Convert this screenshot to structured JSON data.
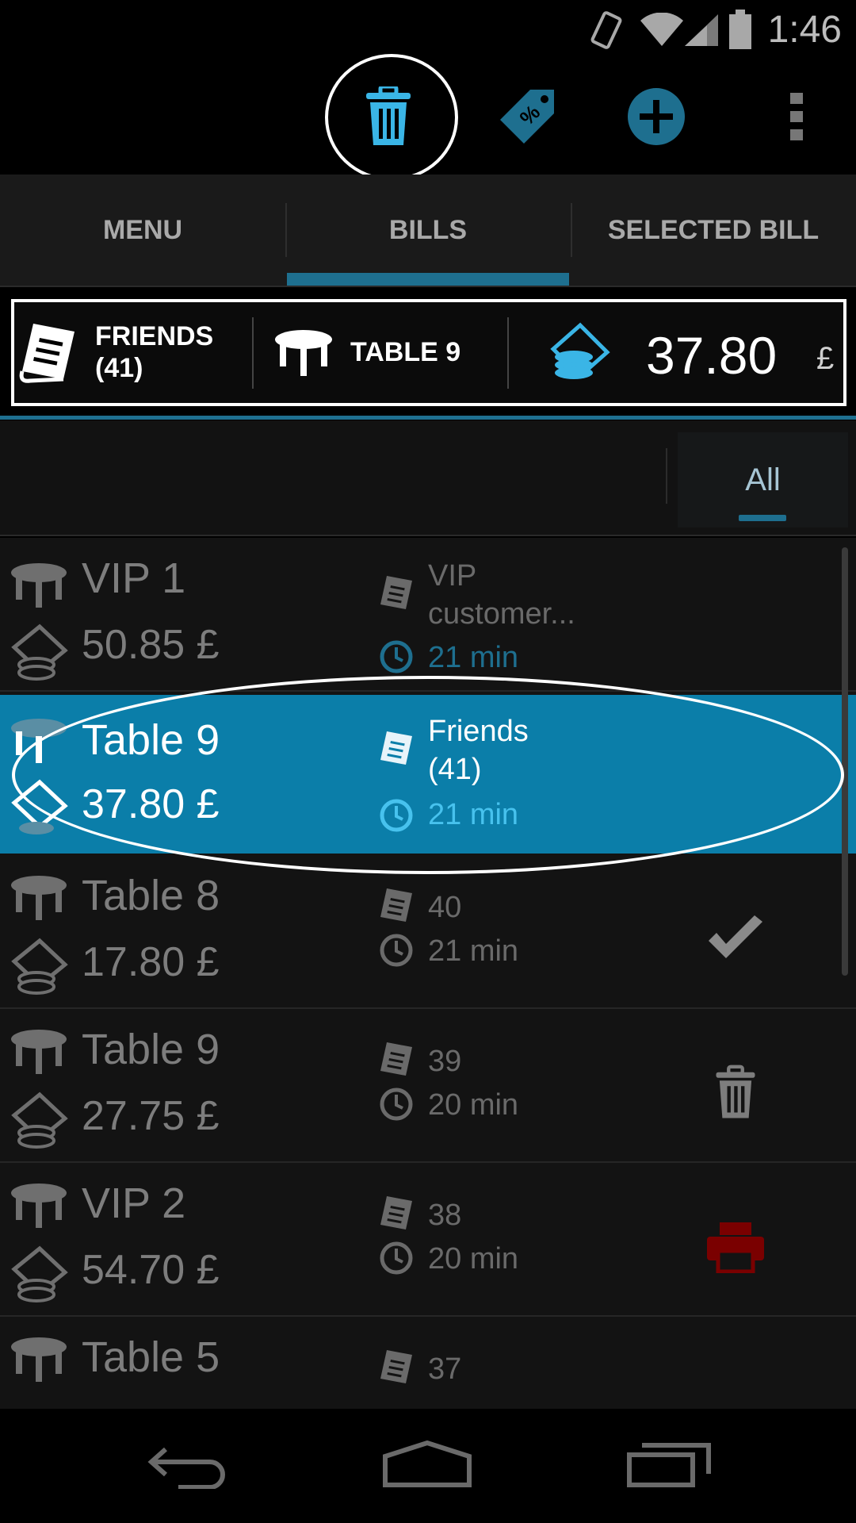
{
  "status_bar": {
    "time": "1:46"
  },
  "action_bar": {
    "icons": [
      "trash-icon",
      "discount-tag-icon",
      "add-icon",
      "overflow-menu-icon"
    ]
  },
  "tabs": [
    {
      "label": "MENU"
    },
    {
      "label": "BILLS"
    },
    {
      "label": "SELECTED BILL"
    }
  ],
  "summary": {
    "bill_name_line1": "FRIENDS",
    "bill_name_line2": "(41)",
    "table": "TABLE 9",
    "amount": "37.80",
    "currency": "£"
  },
  "filter": {
    "label": "All"
  },
  "bills": [
    {
      "name": "VIP 1",
      "amount": "50.85 £",
      "desc": "VIP customer...",
      "time": "21 min",
      "action": ""
    },
    {
      "name": "Table 9",
      "amount": "37.80 £",
      "desc": "Friends (41)",
      "time": "21 min",
      "action": ""
    },
    {
      "name": "Table 8",
      "amount": "17.80 £",
      "desc": "40",
      "time": "21 min",
      "action": "check-icon"
    },
    {
      "name": "Table 9",
      "amount": "27.75 £",
      "desc": "39",
      "time": "20 min",
      "action": "trash-icon"
    },
    {
      "name": "VIP 2",
      "amount": "54.70 £",
      "desc": "38",
      "time": "20 min",
      "action": "printer-icon"
    },
    {
      "name": "Table 5",
      "amount": "",
      "desc": "37",
      "time": "",
      "action": ""
    }
  ],
  "colors": {
    "accent": "#0b7ea9",
    "accent_dark": "#1e6f8f",
    "highlight_blue": "#47c2ee",
    "printer_red": "#7a0000"
  }
}
